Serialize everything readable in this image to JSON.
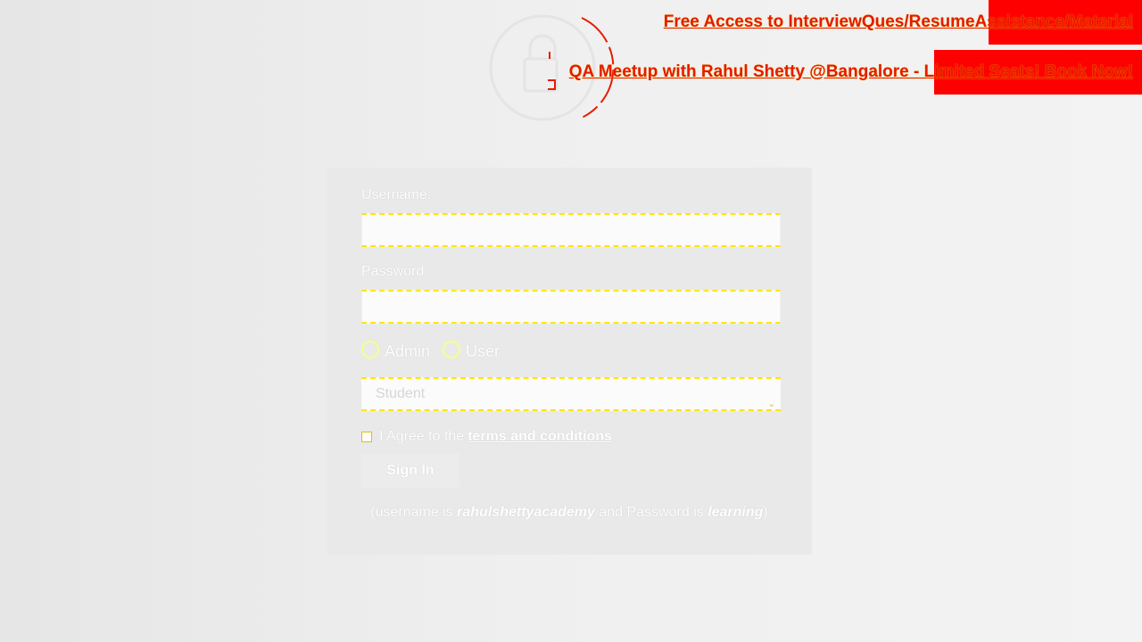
{
  "header": {
    "promo_links": [
      {
        "label": "Free Access to InterviewQues/ResumeAssistance/Material"
      },
      {
        "label": "QA Meetup with Rahul Shetty @Bangalore - Limited Seats! Book Now!"
      }
    ]
  },
  "logo": {
    "icon": "lock-icon"
  },
  "login_form": {
    "username_label": "Username:",
    "username_value": "",
    "password_label": "Password:",
    "password_value": "",
    "role_options": [
      {
        "label": "Admin",
        "selected": false
      },
      {
        "label": "User",
        "selected": false
      }
    ],
    "profile_select": {
      "selected": "Student"
    },
    "terms_prefix": "I Agree to the",
    "terms_link": "terms and conditions",
    "terms_checked": false,
    "signin_label": "Sign In",
    "hint": {
      "open": "(username is ",
      "username": "rahulshettyacademy",
      "middle": " and Password is ",
      "password": "learning",
      "close": ")"
    }
  },
  "colors": {
    "promo_text": "#e51b00",
    "promo_block": "#ff0000",
    "highlight": "#ffe600"
  }
}
